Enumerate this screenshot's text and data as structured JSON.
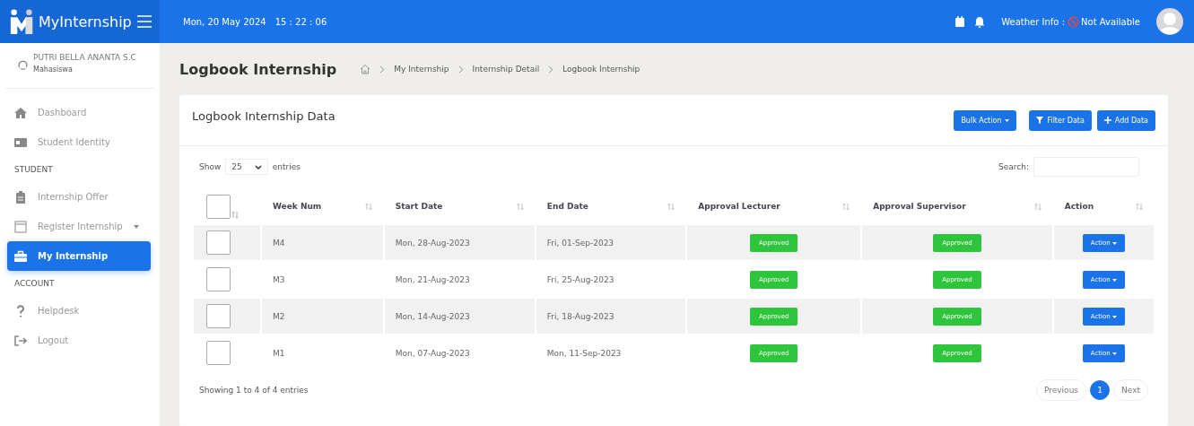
{
  "topbar": {
    "brand": "MyInternship",
    "date": "Mon, 20 May 2024",
    "time": "15 : 22 : 06",
    "weather_label": "Weather Info :",
    "weather_value": "Not Available"
  },
  "sidebar": {
    "user": {
      "name": "PUTRI BELLA ANANTA S.C",
      "role": "Mahasiswa"
    },
    "items": [
      {
        "kind": "link",
        "label": "Dashboard",
        "selected": false
      },
      {
        "kind": "link",
        "label": "Student Identity",
        "selected": false
      },
      {
        "kind": "section",
        "label": "STUDENT"
      },
      {
        "kind": "link",
        "label": "Internship Offer",
        "selected": false
      },
      {
        "kind": "dropdown",
        "label": "Register Internship",
        "selected": false
      },
      {
        "kind": "link",
        "label": "My Internship",
        "selected": true
      },
      {
        "kind": "section",
        "label": "ACCOUNT"
      },
      {
        "kind": "link",
        "label": "Helpdesk",
        "selected": false
      },
      {
        "kind": "link",
        "label": "Logout",
        "selected": false
      }
    ]
  },
  "page": {
    "title": "Logbook Internship",
    "breadcrumb": [
      "My Internship",
      "Internship Detail",
      "Logbook Internship"
    ]
  },
  "card": {
    "title": "Logbook Internship Data",
    "buttons": [
      {
        "kind": "dropdown",
        "label": "Bulk Action"
      },
      {
        "kind": "filter",
        "label": "Filter Data"
      },
      {
        "kind": "add",
        "label": "Add Data"
      }
    ],
    "show_label": "Show",
    "page_size": "25",
    "entries_label": "entries",
    "search_label": "Search:"
  },
  "table": {
    "select_all_checked": false,
    "columns": [
      "Week Num",
      "Start Date",
      "End Date",
      "Approval Lecturer",
      "Approval Supervisor",
      "Action"
    ],
    "rows": [
      {
        "checked": false,
        "week": "M4",
        "start": "Mon, 28-Aug-2023",
        "end": "Fri, 01-Sep-2023",
        "lecturer": "Approved",
        "supervisor": "Approved",
        "action": "Action"
      },
      {
        "checked": false,
        "week": "M3",
        "start": "Mon, 21-Aug-2023",
        "end": "Fri, 25-Aug-2023",
        "lecturer": "Approved",
        "supervisor": "Approved",
        "action": "Action"
      },
      {
        "checked": false,
        "week": "M2",
        "start": "Mon, 14-Aug-2023",
        "end": "Fri, 18-Aug-2023",
        "lecturer": "Approved",
        "supervisor": "Approved",
        "action": "Action"
      },
      {
        "checked": false,
        "week": "M1",
        "start": "Mon, 07-Aug-2023",
        "end": "Mon, 11-Sep-2023",
        "lecturer": "Approved",
        "supervisor": "Approved",
        "action": "Action"
      }
    ]
  },
  "footer": {
    "info": "Showing 1 to 4 of 4 entries",
    "pages": [
      {
        "label": "Previous",
        "kind": "nav",
        "selected": false
      },
      {
        "label": "1",
        "kind": "page",
        "selected": true
      },
      {
        "label": "Next",
        "kind": "nav",
        "selected": false
      }
    ]
  }
}
